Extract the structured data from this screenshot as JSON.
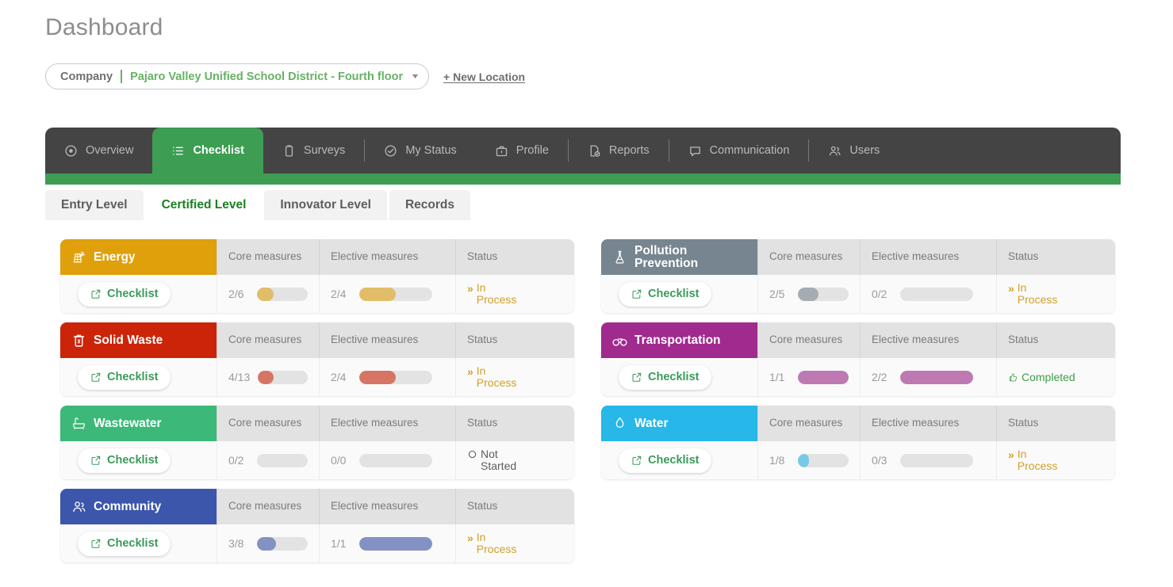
{
  "header": {
    "title": "Dashboard",
    "company_label": "Company",
    "location_value": "Pajaro Valley Unified School District - Fourth floor",
    "caret_icon": "chevron-down-icon",
    "new_location_label": "+ New Location",
    "accent_green": "#67b264"
  },
  "nav": {
    "active_color": "#3d9e53",
    "bar_color": "#444444",
    "tabs": [
      {
        "label": "Overview",
        "icon": "eye-icon",
        "active": false
      },
      {
        "label": "Checklist",
        "icon": "list-icon",
        "active": true
      },
      {
        "label": "Surveys",
        "icon": "clipboard-icon",
        "active": false
      },
      {
        "label": "My Status",
        "icon": "check-circle-icon",
        "active": false
      },
      {
        "label": "Profile",
        "icon": "briefcase-icon",
        "active": false
      },
      {
        "label": "Reports",
        "icon": "report-icon",
        "active": false
      },
      {
        "label": "Communication",
        "icon": "chat-icon",
        "active": false
      },
      {
        "label": "Users",
        "icon": "users-icon",
        "active": false
      }
    ]
  },
  "subtabs": [
    {
      "label": "Entry Level",
      "active": false
    },
    {
      "label": "Certified Level",
      "active": true
    },
    {
      "label": "Innovator Level",
      "active": false
    },
    {
      "label": "Records",
      "active": false
    }
  ],
  "columns": {
    "core": "Core\nmeasures",
    "elective": "Elective\nmeasures",
    "status": "Status"
  },
  "checklist_button_label": "Checklist",
  "cards": [
    {
      "title": "Energy",
      "icon": "solar-panel-icon",
      "color": "#dfa00b",
      "core": {
        "fraction": "2/6",
        "value": 2,
        "total": 6
      },
      "elective": {
        "fraction": "2/4",
        "value": 2,
        "total": 4
      },
      "status": {
        "label": "In\nProcess",
        "kind": "in-process",
        "icon": "double-chevron-icon"
      }
    },
    {
      "title": "Pollution\nPrevention",
      "icon": "flask-icon",
      "color": "#76858f",
      "core": {
        "fraction": "2/5",
        "value": 2,
        "total": 5
      },
      "elective": {
        "fraction": "0/2",
        "value": 0,
        "total": 2
      },
      "status": {
        "label": "In\nProcess",
        "kind": "in-process",
        "icon": "double-chevron-icon"
      }
    },
    {
      "title": "Solid Waste",
      "icon": "trash-icon",
      "color": "#cc2408",
      "core": {
        "fraction": "4/13",
        "value": 4,
        "total": 13
      },
      "elective": {
        "fraction": "2/4",
        "value": 2,
        "total": 4
      },
      "status": {
        "label": "In\nProcess",
        "kind": "in-process",
        "icon": "double-chevron-icon"
      }
    },
    {
      "title": "Transportation",
      "icon": "bicycle-icon",
      "color": "#a12a8e",
      "core": {
        "fraction": "1/1",
        "value": 1,
        "total": 1
      },
      "elective": {
        "fraction": "2/2",
        "value": 2,
        "total": 2
      },
      "status": {
        "label": "Completed",
        "kind": "completed",
        "icon": "thumbs-up-icon"
      }
    },
    {
      "title": "Wastewater",
      "icon": "bathtub-icon",
      "color": "#3cb878",
      "core": {
        "fraction": "0/2",
        "value": 0,
        "total": 2
      },
      "elective": {
        "fraction": "0/0",
        "value": 0,
        "total": 0
      },
      "status": {
        "label": "Not\nStarted",
        "kind": "not-started",
        "icon": "circle-outline-icon"
      }
    },
    {
      "title": "Water",
      "icon": "water-drop-icon",
      "color": "#27b7e8",
      "core": {
        "fraction": "1/8",
        "value": 1,
        "total": 8
      },
      "elective": {
        "fraction": "0/3",
        "value": 0,
        "total": 3
      },
      "status": {
        "label": "In\nProcess",
        "kind": "in-process",
        "icon": "double-chevron-icon"
      }
    },
    {
      "title": "Community",
      "icon": "people-icon",
      "color": "#3c56ab",
      "core": {
        "fraction": "3/8",
        "value": 3,
        "total": 8
      },
      "elective": {
        "fraction": "1/1",
        "value": 1,
        "total": 1
      },
      "status": {
        "label": "In\nProcess",
        "kind": "in-process",
        "icon": "double-chevron-icon"
      }
    }
  ]
}
